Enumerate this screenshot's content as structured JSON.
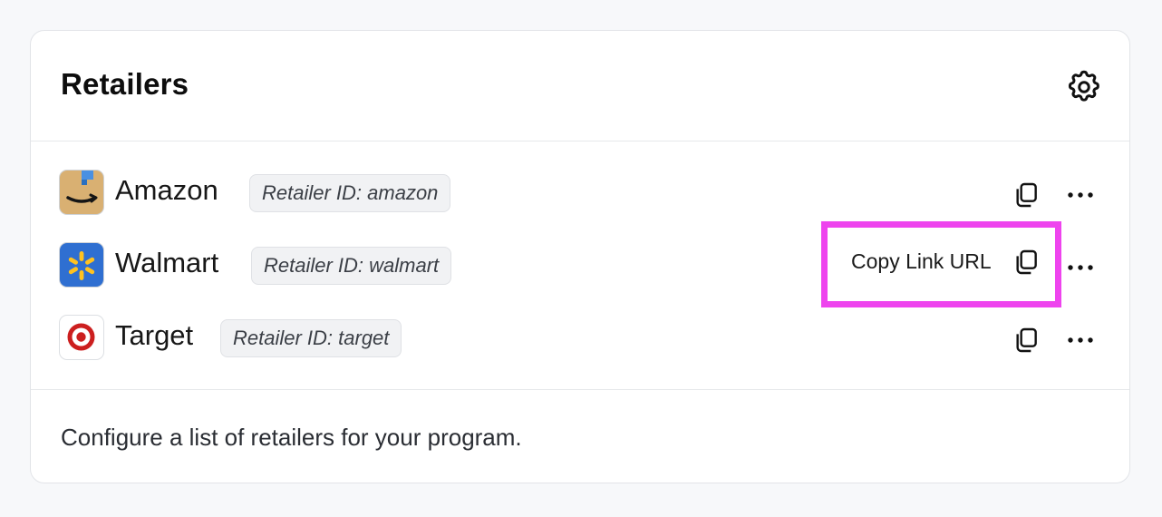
{
  "card": {
    "title": "Retailers",
    "settings_icon": "gear-icon",
    "footer_text": "Configure a list of retailers for your program."
  },
  "retailers": [
    {
      "name": "Amazon",
      "badge": "Retailer ID: amazon",
      "logo_icon": "amazon-logo",
      "logo_color": "#d9b072"
    },
    {
      "name": "Walmart",
      "badge": "Retailer ID: walmart",
      "logo_icon": "walmart-logo",
      "logo_color": "#2f6fd1"
    },
    {
      "name": "Target",
      "badge": "Retailer ID: target",
      "logo_icon": "target-logo",
      "logo_color": "#cc1f1f"
    }
  ],
  "copy_link": {
    "label": "Copy Link URL",
    "icon": "copy-icon"
  },
  "colors": {
    "highlight": "#ee44ee",
    "badge_bg": "#f1f2f4"
  }
}
